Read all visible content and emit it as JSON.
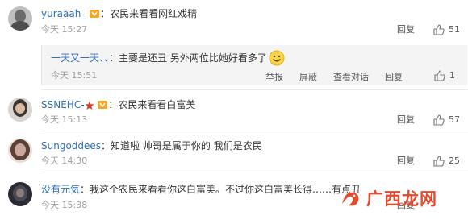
{
  "comments": [
    {
      "username": "yuraaah_",
      "separator": "：",
      "text": "农民来看看网红戏精",
      "time": "今天 15:27",
      "reply_label": "回复",
      "likes": "51",
      "avatar_color": "#6b6b6b",
      "nested": {
        "username": "一天又一天、、",
        "separator": "：",
        "text": "主要是还丑 另外两位比她好看多了",
        "time": "今天 15:51",
        "actions": [
          "举报",
          "屏蔽",
          "查看对话",
          "回复"
        ],
        "likes": "1"
      }
    },
    {
      "username": "SSNEHC-",
      "separator": "：",
      "text": "农民来看看白富美",
      "time": "今天 15:13",
      "reply_label": "回复",
      "likes": "57",
      "avatar_color": "#3d3530"
    },
    {
      "username": "Sungoddees",
      "separator": "：",
      "text": "知道啦  帅哥是属于你的  我们是农民",
      "time": "今天 14:30",
      "reply_label": "回复",
      "likes": "25",
      "avatar_color": "#c9a79a"
    },
    {
      "username": "没有元気",
      "separator": "：",
      "text": "我这个农民来看看你这白富美。不过你这白富美长得……有点丑",
      "time": "今天 15:38",
      "reply_label": "回复",
      "likes": "",
      "avatar_color": "#4a4a55"
    }
  ],
  "colors": {
    "username": "#2f6fba",
    "meta": "#a0a0a0",
    "watermark": "#e64a2e"
  },
  "watermark": {
    "text": "广西龙网"
  }
}
